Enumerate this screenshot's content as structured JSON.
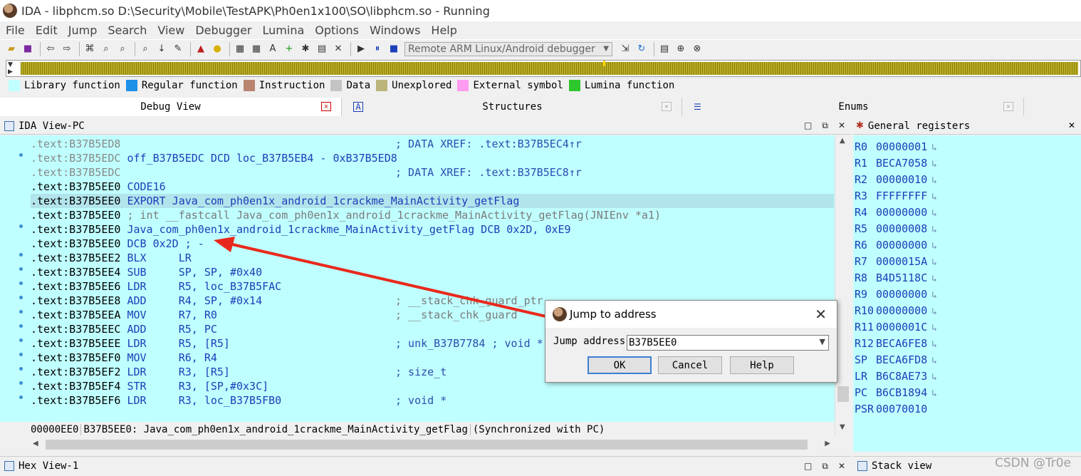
{
  "window": {
    "title": "IDA - libphcm.so D:\\Security\\Mobile\\TestAPK\\Ph0en1x100\\SO\\libphcm.so - Running"
  },
  "menu": [
    "File",
    "Edit",
    "Jump",
    "Search",
    "View",
    "Debugger",
    "Lumina",
    "Options",
    "Windows",
    "Help"
  ],
  "toolbar": {
    "debugger_select": "Remote ARM Linux/Android debugger"
  },
  "legend": [
    {
      "label": "Library function",
      "color": "#c0ffff"
    },
    {
      "label": "Regular function",
      "color": "#1e90e8"
    },
    {
      "label": "Instruction",
      "color": "#b98470"
    },
    {
      "label": "Data",
      "color": "#c4c4c4"
    },
    {
      "label": "Unexplored",
      "color": "#bcb47a"
    },
    {
      "label": "External symbol",
      "color": "#ff9cf0"
    },
    {
      "label": "Lumina function",
      "color": "#2ec82e"
    }
  ],
  "tabs": {
    "debug_view": "Debug View",
    "structures": "Structures",
    "enums": "Enums"
  },
  "ida_view": {
    "title": "IDA View-PC",
    "lines": [
      {
        "addr": ".text:B37B5ED8",
        "grey": true,
        "rest": "",
        "comment": "; DATA XREF: .text:B37B5EC4↑r"
      },
      {
        "addr": ".text:B37B5EDC",
        "grey": true,
        "rest": " off_B37B5EDC DCD loc_B37B5EB4 - 0xB37B5ED8",
        "comment": ""
      },
      {
        "addr": ".text:B37B5EDC",
        "grey": true,
        "rest": "",
        "comment": "; DATA XREF: .text:B37B5EC8↑r"
      },
      {
        "addr": ".text:B37B5EE0",
        "rest": " CODE16",
        "comment": ""
      },
      {
        "addr": ".text:B37B5EE0",
        "rest": " EXPORT Java_com_ph0en1x_android_1crackme_MainActivity_getFlag",
        "comment": ""
      },
      {
        "addr": ".text:B37B5EE0",
        "rest": " ; int __fastcall Java_com_ph0en1x_android_1crackme_MainActivity_getFlag(JNIEnv *a1)",
        "comment": ""
      },
      {
        "addr": ".text:B37B5EE0",
        "rest": " Java_com_ph0en1x_android_1crackme_MainActivity_getFlag DCB 0x2D, 0xE9",
        "comment": ""
      },
      {
        "addr": ".text:B37B5EE0",
        "rest": " DCB 0x2D ; -",
        "comment": ""
      },
      {
        "addr": ".text:B37B5EE2",
        "rest": " BLX     LR",
        "comment": ""
      },
      {
        "addr": ".text:B37B5EE4",
        "rest": " SUB     SP, SP, #0x40",
        "comment": ""
      },
      {
        "addr": ".text:B37B5EE6",
        "rest": " LDR     R5, loc_B37B5FAC",
        "comment": ""
      },
      {
        "addr": ".text:B37B5EE8",
        "rest": " ADD     R4, SP, #0x14",
        "comment": "; __stack_chk_guard_ptr"
      },
      {
        "addr": ".text:B37B5EEA",
        "rest": " MOV     R7, R0",
        "comment": "; __stack_chk_guard"
      },
      {
        "addr": ".text:B37B5EEC",
        "rest": " ADD     R5, PC",
        "comment": ""
      },
      {
        "addr": ".text:B37B5EEE",
        "rest": " LDR     R5, [R5]",
        "comment": "; unk_B37B7784 ; void *"
      },
      {
        "addr": ".text:B37B5EF0",
        "rest": " MOV     R6, R4",
        "comment": ""
      },
      {
        "addr": ".text:B37B5EF2",
        "rest": " LDR     R3, [R5]",
        "comment": "; size_t"
      },
      {
        "addr": ".text:B37B5EF4",
        "rest": " STR     R3, [SP,#0x3C]",
        "comment": ""
      },
      {
        "addr": ".text:B37B5EF6",
        "rest": " LDR     R3, loc_B37B5FB0",
        "comment": "; void *"
      }
    ],
    "status": {
      "offset": "00000EE0",
      "location": "B37B5EE0: Java_com_ph0en1x_android_1crackme_MainActivity_getFlag",
      "sync": "(Synchronized with PC)"
    }
  },
  "registers": {
    "title": "General registers",
    "items": [
      {
        "name": "R0",
        "value": "00000001"
      },
      {
        "name": "R1",
        "value": "BECA7058"
      },
      {
        "name": "R2",
        "value": "00000010"
      },
      {
        "name": "R3",
        "value": "FFFFFFFF"
      },
      {
        "name": "R4",
        "value": "00000000"
      },
      {
        "name": "R5",
        "value": "00000008"
      },
      {
        "name": "R6",
        "value": "00000000"
      },
      {
        "name": "R7",
        "value": "0000015A"
      },
      {
        "name": "R8",
        "value": "B4D5118C"
      },
      {
        "name": "R9",
        "value": "00000000"
      },
      {
        "name": "R10",
        "value": "00000000"
      },
      {
        "name": "R11",
        "value": "0000001C"
      },
      {
        "name": "R12",
        "value": "BECA6FE8"
      },
      {
        "name": "SP",
        "value": "BECA6FD8"
      },
      {
        "name": "LR",
        "value": "B6C8AE73"
      },
      {
        "name": "PC",
        "value": "B6CB1894"
      },
      {
        "name": "PSR",
        "value": "00070010"
      }
    ]
  },
  "bottom": {
    "hex_view": "Hex View-1",
    "stack_view": "Stack view",
    "watermark": "CSDN @Tr0e"
  },
  "dialog": {
    "title": "Jump to address",
    "label": "Jump address",
    "value": "B37B5EE0",
    "ok": "OK",
    "cancel": "Cancel",
    "help": "Help"
  },
  "colors": {
    "code_bg": "#c0ffff",
    "highlight": "#b2e4ec",
    "annotation_arrow": "#e8291c"
  }
}
